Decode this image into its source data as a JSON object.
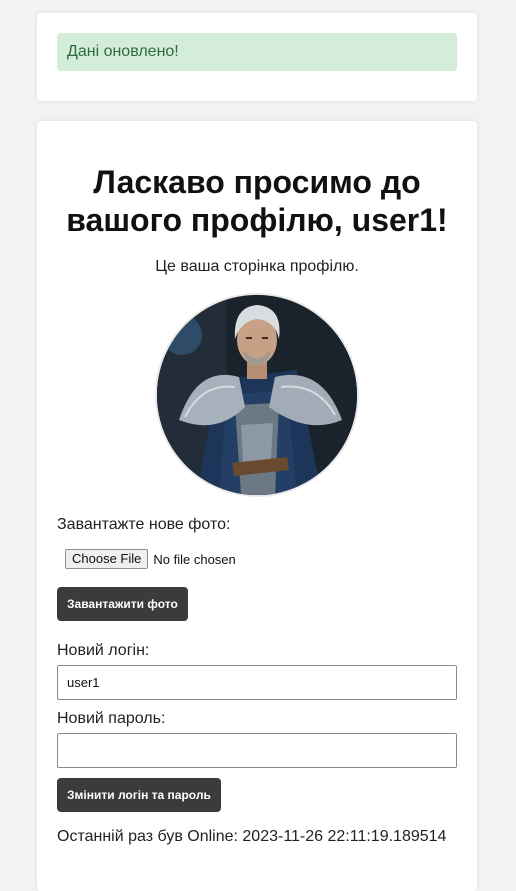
{
  "alert": {
    "message": "Дані оновлено!"
  },
  "profile": {
    "title": "Ласкаво просимо до вашого профілю, user1!",
    "subtitle": "Це ваша сторінка профілю.",
    "avatar_alt": "Аватар користувача"
  },
  "upload": {
    "label": "Завантажте нове фото:",
    "choose_label": "Choose File",
    "no_file_text": "No file chosen",
    "submit_label": "Завантажити фото"
  },
  "credentials": {
    "login_label": "Новий логін:",
    "login_value": "user1",
    "password_label": "Новий пароль:",
    "password_value": "",
    "submit_label": "Змінити логін та пароль"
  },
  "status": {
    "last_online": "Останній раз був Online: 2023-11-26 22:11:19.189514"
  },
  "colors": {
    "alert_bg": "#d4edda",
    "alert_text": "#2f6b3b",
    "button_bg": "#3b3b3b"
  }
}
